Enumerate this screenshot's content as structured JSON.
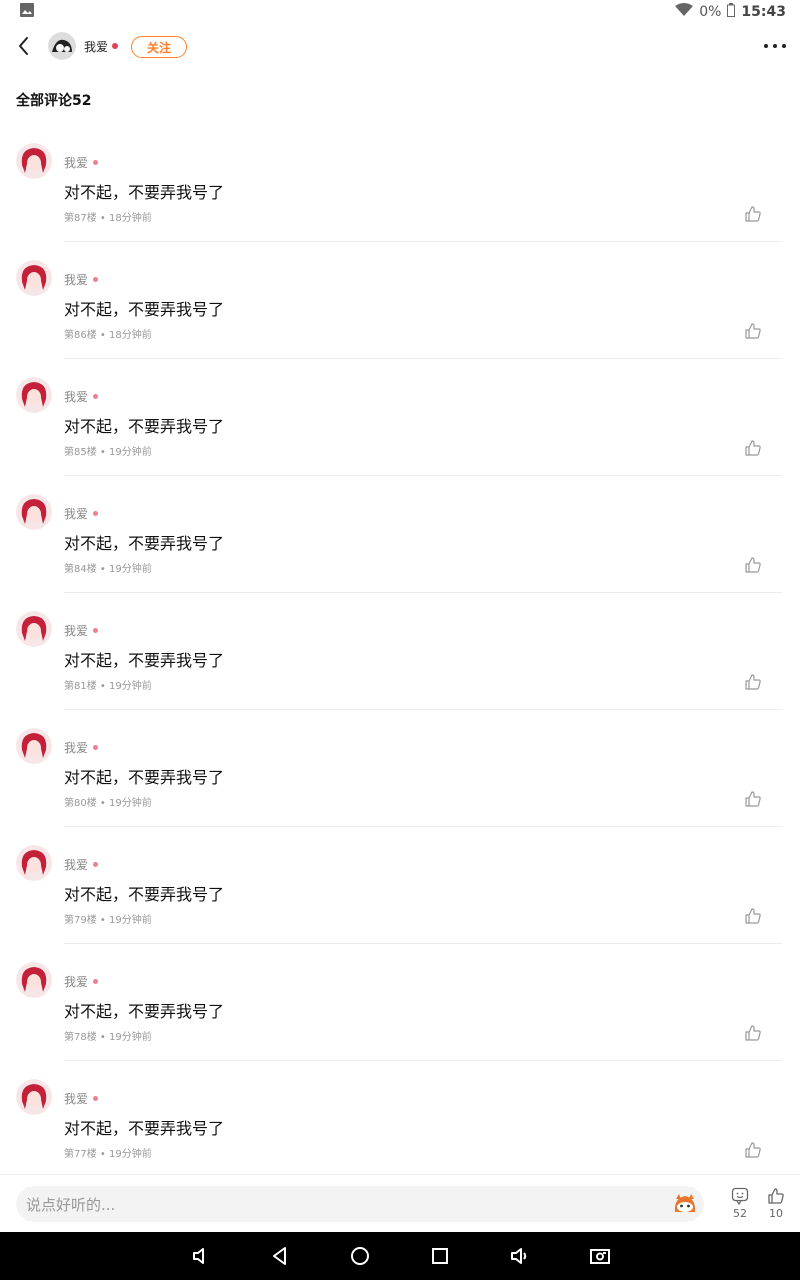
{
  "status_bar": {
    "battery": "0%",
    "time": "15:43"
  },
  "header": {
    "username": "我爱",
    "follow_label": "关注"
  },
  "section": {
    "title": "全部评论52"
  },
  "comments": [
    {
      "name": "我爱",
      "text": "对不起，不要弄我号了",
      "meta": "第87楼 • 18分钟前"
    },
    {
      "name": "我爱",
      "text": "对不起，不要弄我号了",
      "meta": "第86楼 • 18分钟前"
    },
    {
      "name": "我爱",
      "text": "对不起，不要弄我号了",
      "meta": "第85楼 • 19分钟前"
    },
    {
      "name": "我爱",
      "text": "对不起，不要弄我号了",
      "meta": "第84楼 • 19分钟前"
    },
    {
      "name": "我爱",
      "text": "对不起，不要弄我号了",
      "meta": "第81楼 • 19分钟前"
    },
    {
      "name": "我爱",
      "text": "对不起，不要弄我号了",
      "meta": "第80楼 • 19分钟前"
    },
    {
      "name": "我爱",
      "text": "对不起，不要弄我号了",
      "meta": "第79楼 • 19分钟前"
    },
    {
      "name": "我爱",
      "text": "对不起，不要弄我号了",
      "meta": "第78楼 • 19分钟前"
    },
    {
      "name": "我爱",
      "text": "对不起，不要弄我号了",
      "meta": "第77楼 • 19分钟前"
    }
  ],
  "bottom_bar": {
    "input_placeholder": "说点好听的...",
    "comment_count": "52",
    "like_count": "10"
  },
  "colors": {
    "accent": "#ff7f2a",
    "dot": "#e33e55",
    "avatar": "#c4203a"
  },
  "icons": [
    "back-icon",
    "more-icon",
    "thumb-up-icon",
    "emoji-icon",
    "comment-icon",
    "wifi-icon",
    "battery-icon",
    "image-icon"
  ]
}
